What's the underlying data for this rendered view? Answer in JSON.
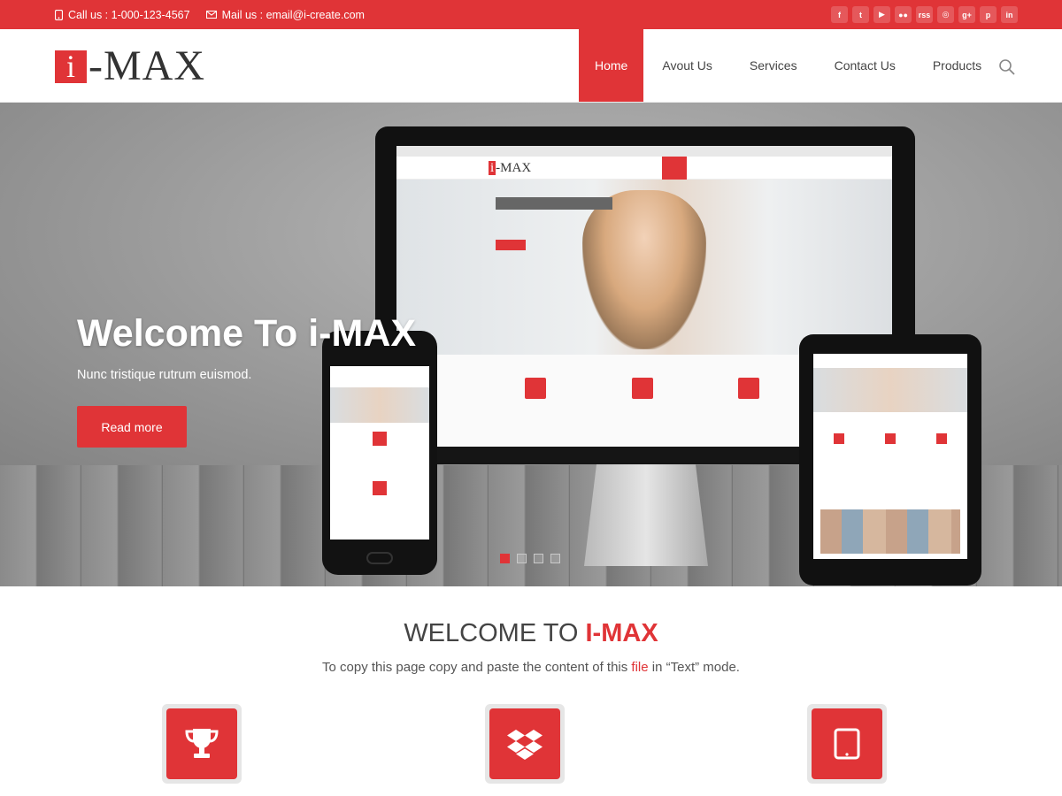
{
  "topbar": {
    "phone_text": "Call us : 1-000-123-4567",
    "mail_text": "Mail us : email@i-create.com",
    "social": [
      "f",
      "t",
      "▶",
      "●●",
      "rss",
      "◎",
      "g+",
      "p",
      "in"
    ]
  },
  "header": {
    "logo_mark": "i",
    "logo_text": "-MAX",
    "nav": [
      "Home",
      "Avout Us",
      "Services",
      "Contact Us",
      "Products"
    ]
  },
  "hero": {
    "title": "Welcome To i-MAX",
    "subtitle": "Nunc tristique rutrum euismod.",
    "button": "Read more",
    "slides": 4,
    "active_slide": 1
  },
  "welcome": {
    "title_plain": "WELCOME TO ",
    "title_accent": "I-MAX",
    "sub_before": "To copy this page copy and paste the content of this ",
    "sub_link": "file",
    "sub_after": " in “Text” mode."
  },
  "features": [
    {
      "icon": "trophy-icon"
    },
    {
      "icon": "dropbox-icon"
    },
    {
      "icon": "tablet-icon"
    }
  ],
  "colors": {
    "accent": "#e03437",
    "text": "#444444"
  }
}
